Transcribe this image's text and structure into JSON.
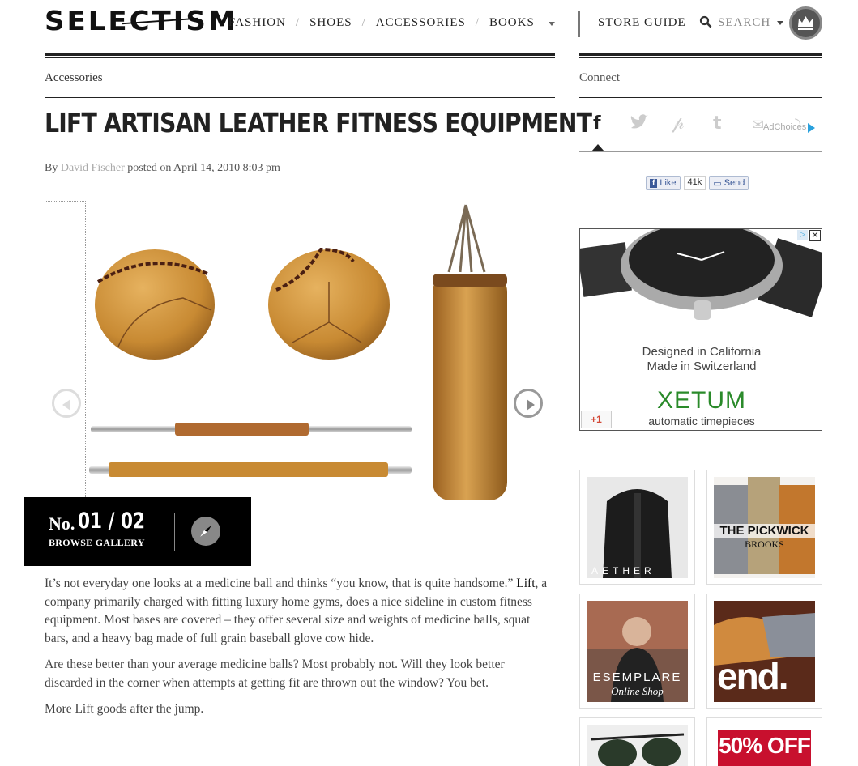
{
  "site": {
    "logo": "SELECTISM"
  },
  "nav": {
    "items": [
      "FASHION",
      "SHOES",
      "ACCESSORIES",
      "BOOKS"
    ],
    "store_guide": "STORE GUIDE",
    "search": "SEARCH"
  },
  "breadcrumb": "Accessories",
  "sidebar": {
    "heading": "Connect",
    "adchoices": "AdChoices",
    "fb_like": "Like",
    "fb_count": "41k",
    "fb_send": "Send"
  },
  "article": {
    "title": "LIFT ARTISAN LEATHER FITNESS EQUIPMENT",
    "by": "By",
    "author": "David Fischer",
    "posted": "posted on April 14, 2010 8:03 pm",
    "p1_pre": "It’s not everyday one looks at a medicine ball and thinks “you know, that is quite handsome.”",
    "p1_link": "Lift",
    "p1_post": ", a company primarily charged with fitting luxury home gyms, does a nice sideline in custom fitness equipment. Most bases are covered – they offer several size and weights of medicine balls, squat bars, and a heavy bag made of full grain baseball glove cow hide.",
    "p2": "Are these better than your average medicine balls? Most probably not. Will they look better discarded in the corner when attempts at getting fit are thrown out the window? You bet.",
    "p3": "More Lift goods after the jump."
  },
  "gallery": {
    "no": "No.",
    "counter": "01 / 02",
    "browse": "BROWSE GALLERY"
  },
  "ad": {
    "line1": "Designed in California",
    "line2": "Made in Switzerland",
    "brand": "XETUM",
    "tagline": "automatic timepieces",
    "gplus": "+1",
    "close": "✕",
    "tag": "▷"
  },
  "shops": {
    "aether": "AETHER",
    "pickwick": "THE PICKWICK",
    "brooks": "BROOKS",
    "esemplare": "ESEMPLARE",
    "online_shop": "Online Shop",
    "end": "end.",
    "sale": "50% OFF"
  },
  "colors": {
    "text": "#444444",
    "rule": "#222222",
    "author": "#aaaaaa",
    "xetum_green": "#2a8a2a",
    "facebook": "#3b5998",
    "sale_red": "#c8102e"
  },
  "icons": {
    "search": "search-icon",
    "crown": "crown-icon",
    "prev": "arrow-left-icon",
    "next": "arrow-right-icon",
    "compass": "compass-icon",
    "facebook": "facebook-icon",
    "twitter": "twitter-icon",
    "pinterest": "pinterest-icon",
    "tumblr": "tumblr-icon",
    "mail": "mail-icon",
    "rss": "rss-icon"
  }
}
